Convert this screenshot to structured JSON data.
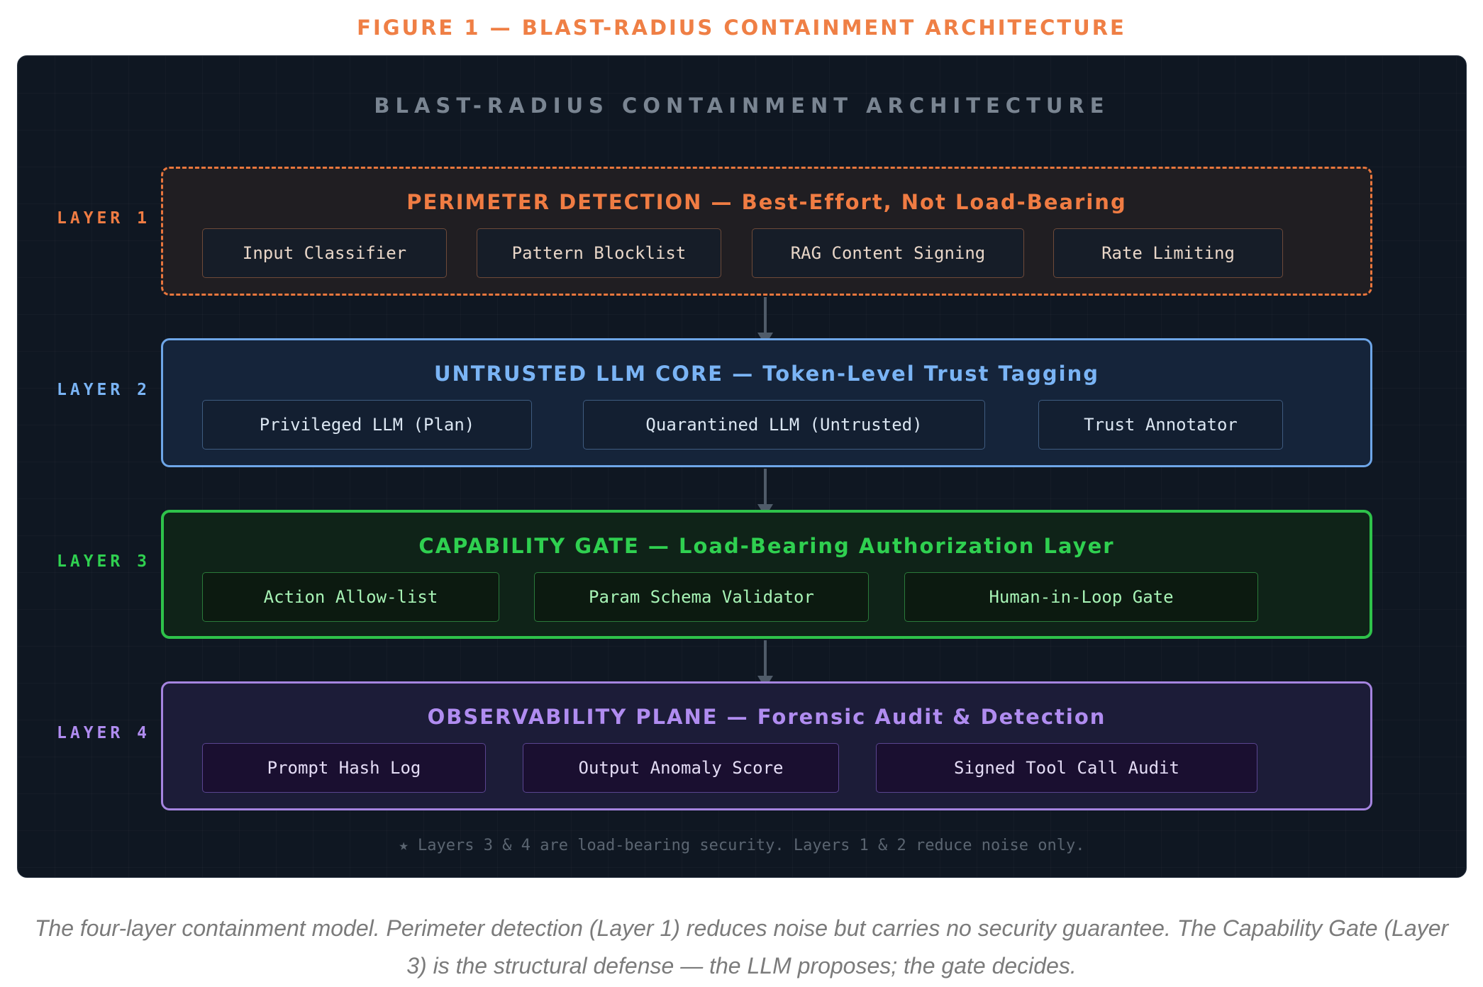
{
  "figure_title": "FIGURE 1 — BLAST-RADIUS CONTAINMENT ARCHITECTURE",
  "panel_title": "BLAST-RADIUS CONTAINMENT ARCHITECTURE",
  "colors": {
    "layer1": "#f07c43",
    "layer2": "#7ab4f5",
    "layer3": "#2fd050",
    "layer4": "#b08cf0",
    "panel_background": "#0f1722"
  },
  "layers": [
    {
      "label": "LAYER 1",
      "heading": "PERIMETER DETECTION — Best-Effort, Not Load-Bearing",
      "border_style": "dashed",
      "components": [
        "Input Classifier",
        "Pattern Blocklist",
        "RAG Content Signing",
        "Rate Limiting"
      ]
    },
    {
      "label": "LAYER 2",
      "heading": "UNTRUSTED LLM CORE — Token-Level Trust Tagging",
      "border_style": "solid",
      "components": [
        "Privileged LLM (Plan)",
        "Quarantined LLM (Untrusted)",
        "Trust Annotator"
      ]
    },
    {
      "label": "LAYER 3",
      "heading": "CAPABILITY GATE — Load-Bearing Authorization Layer",
      "border_style": "solid",
      "components": [
        "Action Allow-list",
        "Param Schema Validator",
        "Human-in-Loop Gate"
      ]
    },
    {
      "label": "LAYER 4",
      "heading": "OBSERVABILITY PLANE — Forensic Audit & Detection",
      "border_style": "solid",
      "components": [
        "Prompt Hash Log",
        "Output Anomaly Score",
        "Signed Tool Call Audit"
      ]
    }
  ],
  "footnote": "★ Layers 3 & 4 are load-bearing security. Layers 1 & 2 reduce noise only.",
  "caption": "The four-layer containment model. Perimeter detection (Layer 1) reduces noise but carries no security guarantee. The Capability Gate (Layer 3) is the structural defense — the LLM proposes; the gate decides."
}
